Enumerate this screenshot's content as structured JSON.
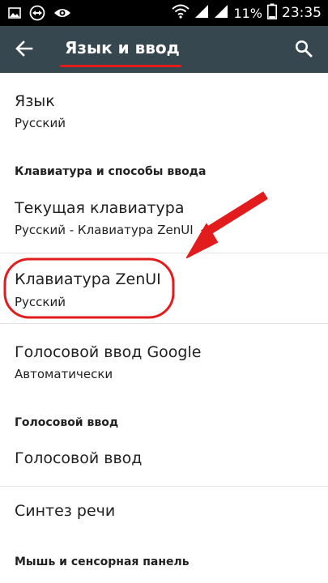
{
  "status_bar": {
    "battery": "11%",
    "time": "23:35"
  },
  "toolbar": {
    "title": "Язык и ввод"
  },
  "items": {
    "language": {
      "title": "Язык",
      "summary": "Русский"
    },
    "category_keyboards": "Клавиатура и способы ввода",
    "current_keyboard": {
      "title": "Текущая клавиатура",
      "summary": "Русский - Клавиатура ZenUI"
    },
    "zenui_keyboard": {
      "title": "Клавиатура ZenUI",
      "summary": "Русский"
    },
    "google_voice": {
      "title": "Голосовой ввод Google",
      "summary": "Автоматически"
    },
    "category_voice": "Голосовой ввод",
    "voice_input": {
      "title": "Голосовой ввод"
    },
    "tts": {
      "title": "Синтез речи"
    },
    "category_mouse": "Мышь и сенсорная панель"
  },
  "colors": {
    "toolbar": "#37474f",
    "status_bar": "#000000",
    "annotation": "#e21c1c"
  }
}
